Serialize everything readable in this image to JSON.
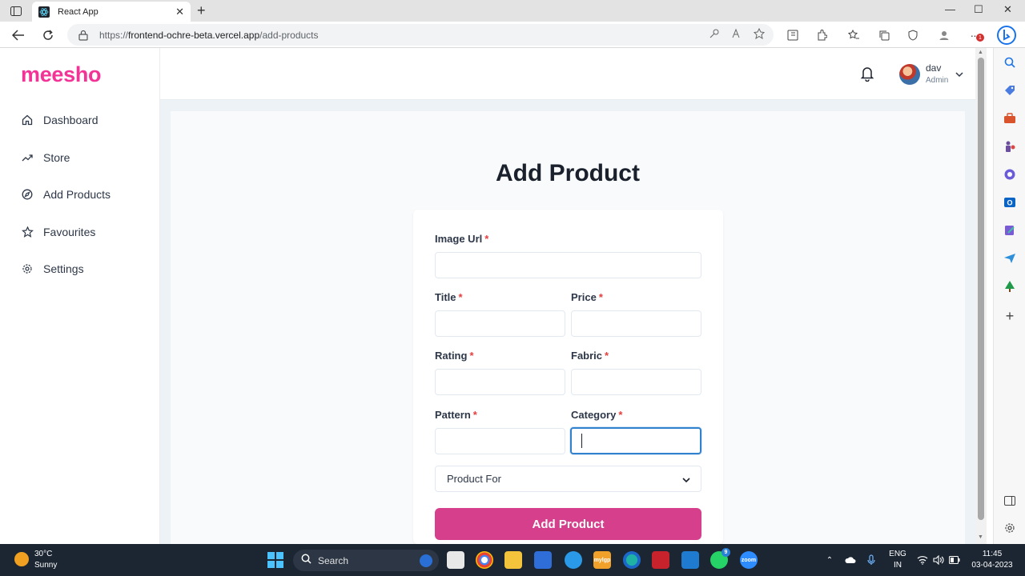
{
  "browser": {
    "tab_title": "React App",
    "url_prefix": "https://",
    "url_host": "frontend-ochre-beta.vercel.app",
    "url_path": "/add-products",
    "new_tab": "+",
    "tab_close": "✕",
    "win_minimize": "—",
    "win_maximize": "☐",
    "win_close": "✕",
    "notification_badge": "1"
  },
  "app": {
    "logo": "meesho",
    "sidebar": {
      "items": [
        {
          "label": "Dashboard",
          "icon": "home-icon"
        },
        {
          "label": "Store",
          "icon": "trending-up-icon"
        },
        {
          "label": "Add Products",
          "icon": "compass-icon"
        },
        {
          "label": "Favourites",
          "icon": "star-icon"
        },
        {
          "label": "Settings",
          "icon": "gear-icon"
        }
      ]
    },
    "header": {
      "user_name": "dav",
      "user_role": "Admin"
    },
    "page_title": "Add Product",
    "form": {
      "required_mark": "*",
      "image_url_label": "Image Url",
      "title_label": "Title",
      "price_label": "Price",
      "rating_label": "Rating",
      "fabric_label": "Fabric",
      "pattern_label": "Pattern",
      "category_label": "Category",
      "product_for_placeholder": "Product For",
      "submit_label": "Add Product",
      "values": {
        "image_url": "",
        "title": "",
        "price": "",
        "rating": "",
        "fabric": "",
        "pattern": "",
        "category": ""
      }
    }
  },
  "taskbar": {
    "temperature": "30°C",
    "condition": "Sunny",
    "search_label": "Search",
    "language_top": "ENG",
    "language_bottom": "IN",
    "time": "11:45",
    "date": "03-04-2023",
    "whatsapp_badge": "9",
    "mylgp_label": "mylgp",
    "zoom_label": "zoom"
  },
  "colors": {
    "brand": "#f43397",
    "submit": "#d53f8c",
    "focus": "#3182ce",
    "required": "#e53e3e"
  }
}
